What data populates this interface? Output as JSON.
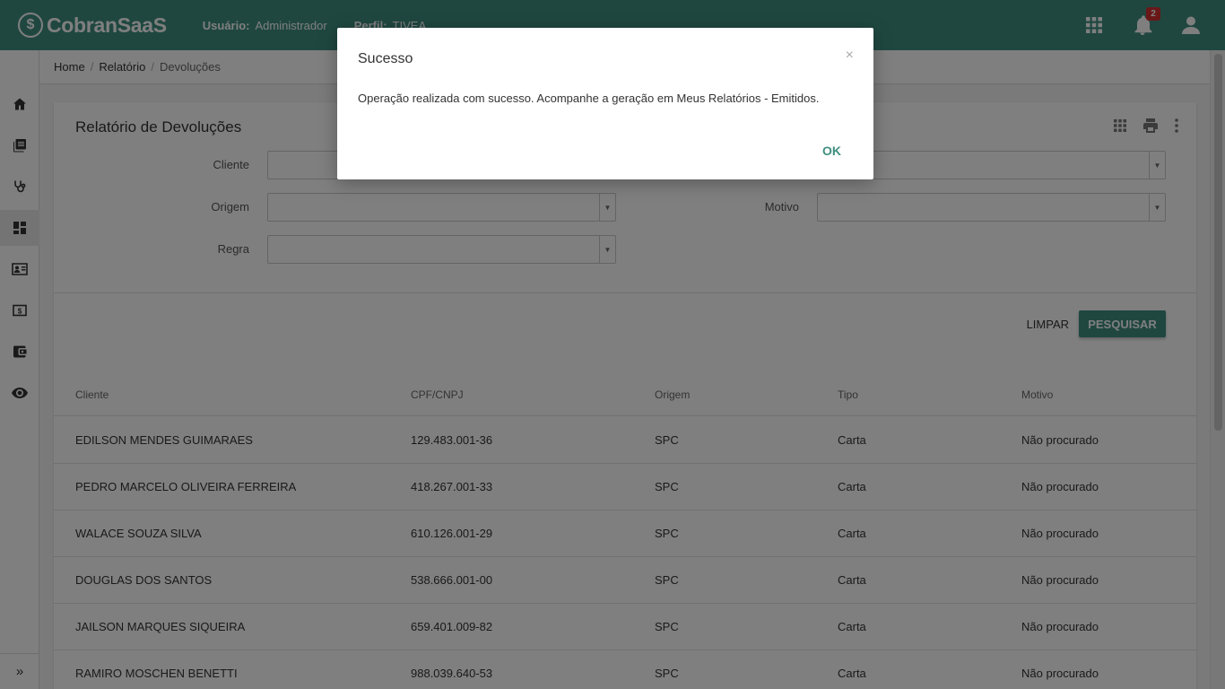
{
  "header": {
    "logo_mark": "$",
    "brand": "CobranSaaS",
    "user_label": "Usuário:",
    "user_value": "Administrador",
    "profile_label": "Perfil:",
    "profile_value": "TIVEA",
    "notification_count": "2"
  },
  "breadcrumb": {
    "items": [
      "Home",
      "Relatório",
      "Devoluções"
    ]
  },
  "sidebar": {
    "items": [
      "home-icon",
      "library-books-icon",
      "stethoscope-icon",
      "dashboard-icon",
      "contact-card-icon",
      "money-icon",
      "wallet-icon",
      "eye-icon"
    ],
    "expand": "»"
  },
  "report": {
    "title": "Relatório de Devoluções",
    "filters": {
      "cliente_label": "Cliente",
      "origem_label": "Origem",
      "motivo_label": "Motivo",
      "regra_label": "Regra"
    },
    "btn_limpar": "LIMPAR",
    "btn_pesquisar": "PESQUISAR"
  },
  "table": {
    "headers": [
      "Cliente",
      "CPF/CNPJ",
      "Origem",
      "Tipo",
      "Motivo"
    ],
    "rows": [
      [
        "EDILSON MENDES GUIMARAES",
        "129.483.001-36",
        "SPC",
        "Carta",
        "Não procurado"
      ],
      [
        "PEDRO MARCELO OLIVEIRA FERREIRA",
        "418.267.001-33",
        "SPC",
        "Carta",
        "Não procurado"
      ],
      [
        "WALACE SOUZA SILVA",
        "610.126.001-29",
        "SPC",
        "Carta",
        "Não procurado"
      ],
      [
        "DOUGLAS DOS SANTOS",
        "538.666.001-00",
        "SPC",
        "Carta",
        "Não procurado"
      ],
      [
        "JAILSON MARQUES SIQUEIRA",
        "659.401.009-82",
        "SPC",
        "Carta",
        "Não procurado"
      ],
      [
        "RAMIRO MOSCHEN BENETTI",
        "988.039.640-53",
        "SPC",
        "Carta",
        "Não procurado"
      ]
    ]
  },
  "modal": {
    "title": "Sucesso",
    "close": "×",
    "message": "Operação realizada com sucesso. Acompanhe a geração em Meus Relatórios - Emitidos.",
    "ok": "OK"
  },
  "colors": {
    "brand": "#3f8f80",
    "badge": "#d32f2f"
  }
}
